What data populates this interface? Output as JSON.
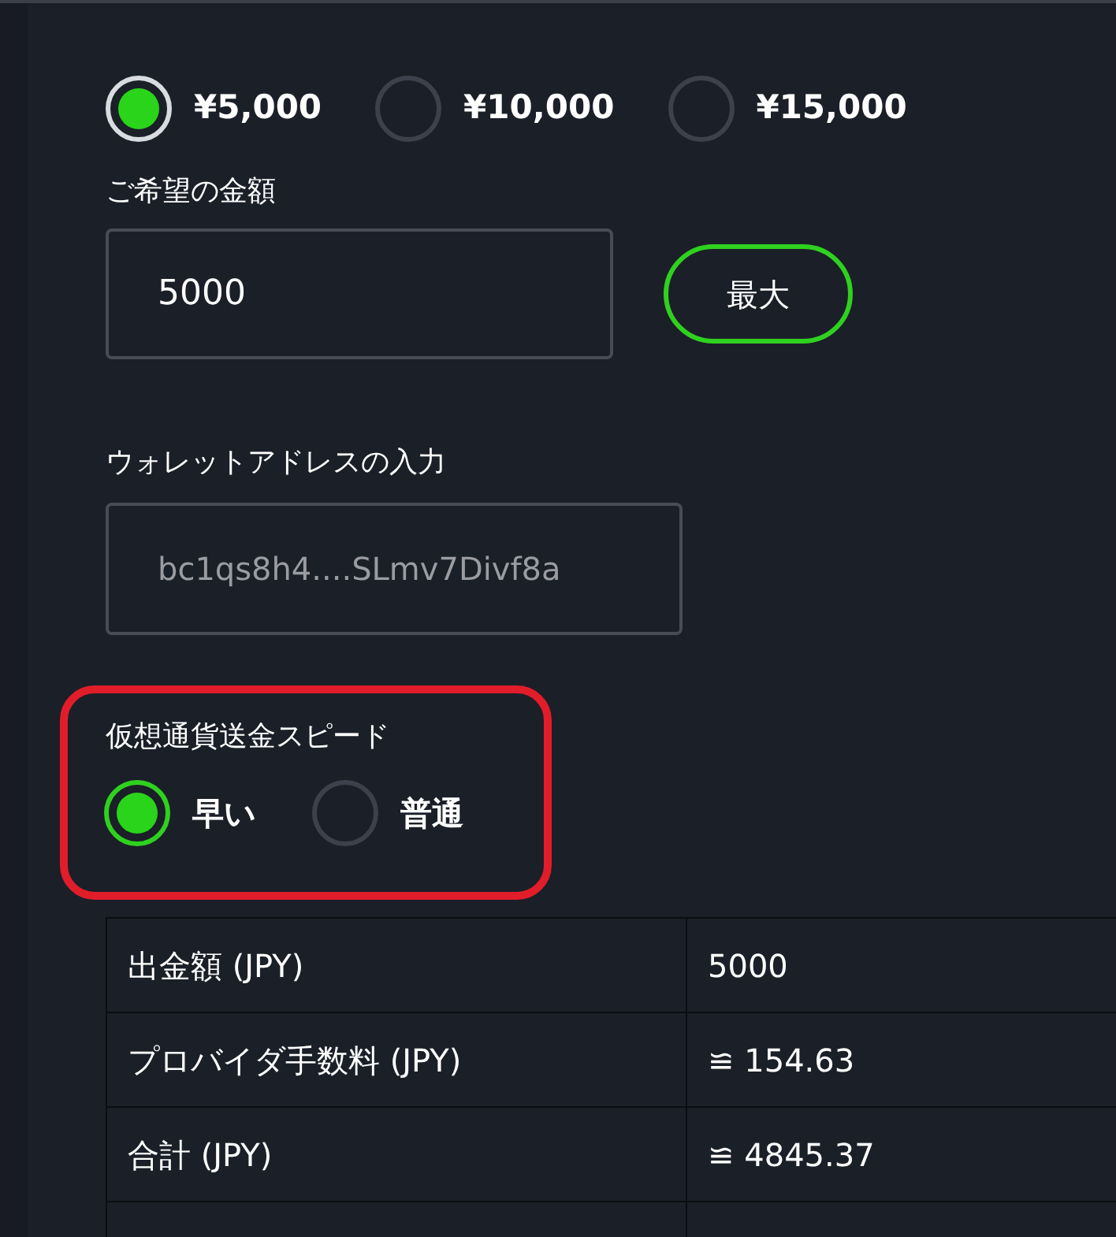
{
  "amount_options": [
    {
      "label": "¥5,000",
      "selected": true
    },
    {
      "label": "¥10,000",
      "selected": false
    },
    {
      "label": "¥15,000",
      "selected": false
    }
  ],
  "amount": {
    "label": "ご希望の金額",
    "value": "5000",
    "max_button": "最大"
  },
  "wallet": {
    "label": "ウォレットアドレスの入力",
    "placeholder": "bc1qs8h4....SLmv7Divf8a"
  },
  "speed": {
    "label": "仮想通貨送金スピード",
    "options": [
      {
        "label": "早い",
        "selected": true
      },
      {
        "label": "普通",
        "selected": false
      }
    ]
  },
  "table": {
    "rows": [
      [
        "出金額 (JPY)",
        "5000"
      ],
      [
        "プロバイダ手数料 (JPY)",
        "≌ 154.63"
      ],
      [
        "合計 (JPY)",
        "≌ 4845.37"
      ]
    ]
  }
}
